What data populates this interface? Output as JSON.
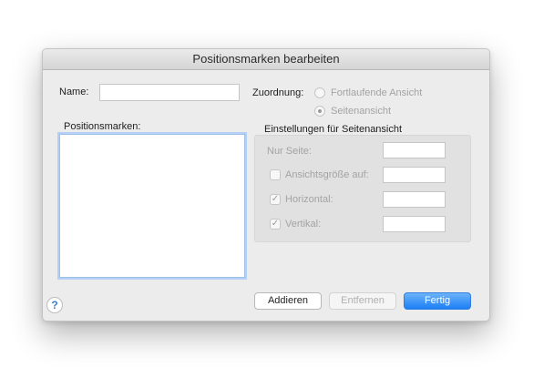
{
  "dialog": {
    "title": "Positionsmarken bearbeiten",
    "name_label": "Name:",
    "name_value": "",
    "zuordnung_label": "Zuordnung:",
    "radio_fortlaufend": "Fortlaufende Ansicht",
    "radio_seitenansicht": "Seitenansicht",
    "selected_zuordnung": "Seitenansicht",
    "positionsmarken_label": "Positionsmarken:",
    "positionsmarken_items": [],
    "group_title": "Einstellungen für Seitenansicht",
    "nur_seite_label": "Nur Seite:",
    "nur_seite_value": "",
    "ansichtsgroesse_label": "Ansichtsgröße auf:",
    "ansichtsgroesse_checked": false,
    "ansichtsgroesse_value": "",
    "horizontal_label": "Horizontal:",
    "horizontal_checked": true,
    "horizontal_value": "",
    "vertikal_label": "Vertikal:",
    "vertikal_checked": true,
    "vertikal_value": "",
    "buttons": {
      "addieren": "Addieren",
      "entfernen": "Entfernen",
      "fertig": "Fertig"
    },
    "help_glyph": "?",
    "check_glyph": "✓",
    "accent_color": "#1d7ef5"
  }
}
